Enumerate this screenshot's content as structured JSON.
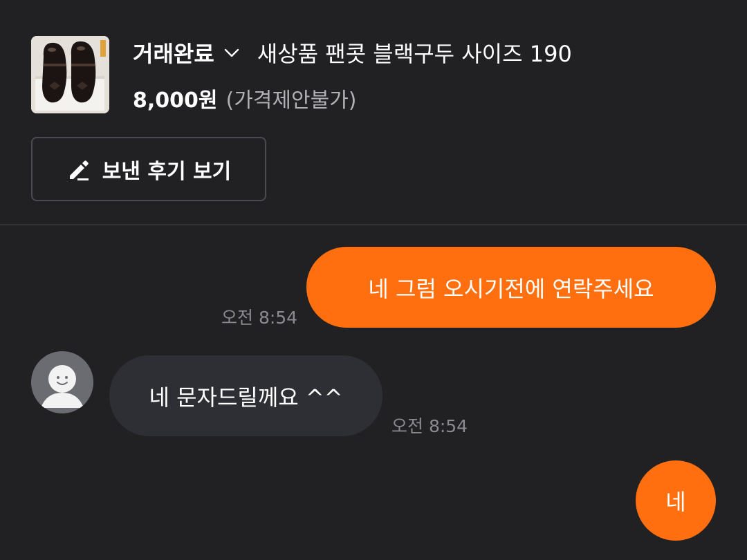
{
  "product": {
    "status": "거래완료",
    "title": "새상품 팬콧 블랙구두 사이즈 190",
    "price": "8,000원",
    "price_note": "(가격제안불가)",
    "thumbnail_icon": "shoes-photo"
  },
  "review_button": {
    "label": "보낸 후기 보기",
    "icon": "pencil-icon"
  },
  "messages": [
    {
      "sender": "me",
      "text": "네 그럼 오시기전에 연락주세요",
      "time": "오전 8:54"
    },
    {
      "sender": "other",
      "text": "네 문자드릴께요 ^^",
      "time": "오전 8:54"
    },
    {
      "sender": "me",
      "text": "네",
      "time": ""
    }
  ],
  "colors": {
    "background": "#212124",
    "accent": "#ff6f0f",
    "other_bubble": "#2e2f34",
    "muted_text": "#8a8b90"
  }
}
